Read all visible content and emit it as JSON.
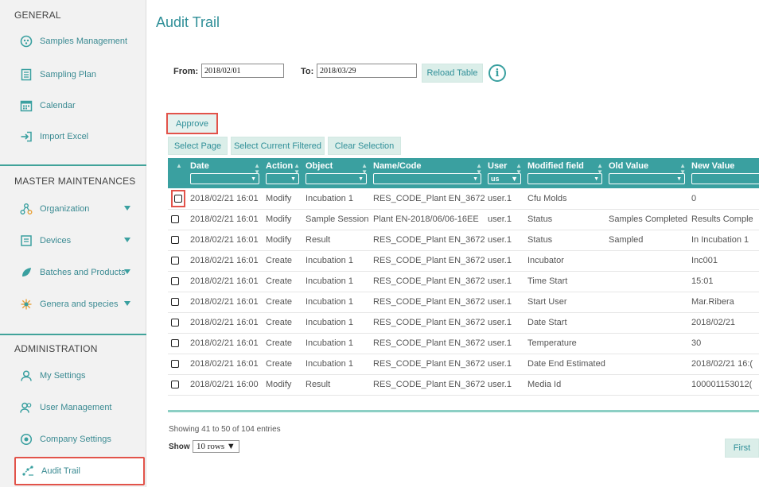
{
  "sidebar": {
    "general_title": "GENERAL",
    "general_items": [
      {
        "label": "Samples Management",
        "icon": "samples-icon"
      },
      {
        "label": "Sampling Plan",
        "icon": "sampling-plan-icon"
      },
      {
        "label": "Calendar",
        "icon": "calendar-icon"
      },
      {
        "label": "Import Excel",
        "icon": "import-icon"
      }
    ],
    "master_title": "MASTER MAINTENANCES",
    "master_items": [
      {
        "label": "Organization",
        "icon": "organization-icon"
      },
      {
        "label": "Devices",
        "icon": "devices-icon"
      },
      {
        "label": "Batches and Products",
        "icon": "leaf-icon"
      },
      {
        "label": "Genera and species",
        "icon": "species-icon"
      }
    ],
    "admin_title": "ADMINISTRATION",
    "admin_items": [
      {
        "label": "My Settings",
        "icon": "user-icon"
      },
      {
        "label": "User Management",
        "icon": "users-icon"
      },
      {
        "label": "Company Settings",
        "icon": "settings-icon"
      },
      {
        "label": "Audit Trail",
        "icon": "audit-icon"
      }
    ]
  },
  "page": {
    "title": "Audit Trail"
  },
  "filters": {
    "from_label": "From:",
    "from_value": "2018/02/01",
    "to_label": "To:",
    "to_value": "2018/03/29",
    "reload_label": "Reload Table",
    "info_glyph": "i"
  },
  "actions": {
    "approve": "Approve",
    "select_page": "Select Page",
    "select_filtered": "Select Current Filtered",
    "clear_selection": "Clear Selection"
  },
  "table": {
    "columns": [
      "Date",
      "Action",
      "Object",
      "Name/Code",
      "User",
      "Modified field",
      "Old Value",
      "New Value"
    ],
    "user_filter_value": "us",
    "rows": [
      [
        "2018/02/21 16:01",
        "Modify",
        "Incubation 1",
        "RES_CODE_Plant EN_3672",
        "user.1",
        "Cfu Molds",
        "",
        "0"
      ],
      [
        "2018/02/21 16:01",
        "Modify",
        "Sample Session",
        "Plant EN-2018/06/06-16EE",
        "user.1",
        "Status",
        "Samples Completed",
        "Results Comple"
      ],
      [
        "2018/02/21 16:01",
        "Modify",
        "Result",
        "RES_CODE_Plant EN_3672",
        "user.1",
        "Status",
        "Sampled",
        "In Incubation 1"
      ],
      [
        "2018/02/21 16:01",
        "Create",
        "Incubation 1",
        "RES_CODE_Plant EN_3672",
        "user.1",
        "Incubator",
        "",
        "Inc001"
      ],
      [
        "2018/02/21 16:01",
        "Create",
        "Incubation 1",
        "RES_CODE_Plant EN_3672",
        "user.1",
        "Time Start",
        "",
        "15:01"
      ],
      [
        "2018/02/21 16:01",
        "Create",
        "Incubation 1",
        "RES_CODE_Plant EN_3672",
        "user.1",
        "Start User",
        "",
        "Mar.Ribera"
      ],
      [
        "2018/02/21 16:01",
        "Create",
        "Incubation 1",
        "RES_CODE_Plant EN_3672",
        "user.1",
        "Date Start",
        "",
        "2018/02/21"
      ],
      [
        "2018/02/21 16:01",
        "Create",
        "Incubation 1",
        "RES_CODE_Plant EN_3672",
        "user.1",
        "Temperature",
        "",
        "30"
      ],
      [
        "2018/02/21 16:01",
        "Create",
        "Incubation 1",
        "RES_CODE_Plant EN_3672",
        "user.1",
        "Date End Estimated",
        "",
        "2018/02/21 16:("
      ],
      [
        "2018/02/21 16:00",
        "Modify",
        "Result",
        "RES_CODE_Plant EN_3672",
        "user.1",
        "Media Id",
        "",
        "100001153012("
      ]
    ]
  },
  "footer": {
    "entries_text": "Showing 41 to 50 of 104 entries",
    "show_label": "Show",
    "rows_option": "10 rows",
    "first_label": "First"
  },
  "colors": {
    "accent": "#3aa0a0",
    "highlight": "#e2534a",
    "button_bg": "#dbeee9"
  }
}
